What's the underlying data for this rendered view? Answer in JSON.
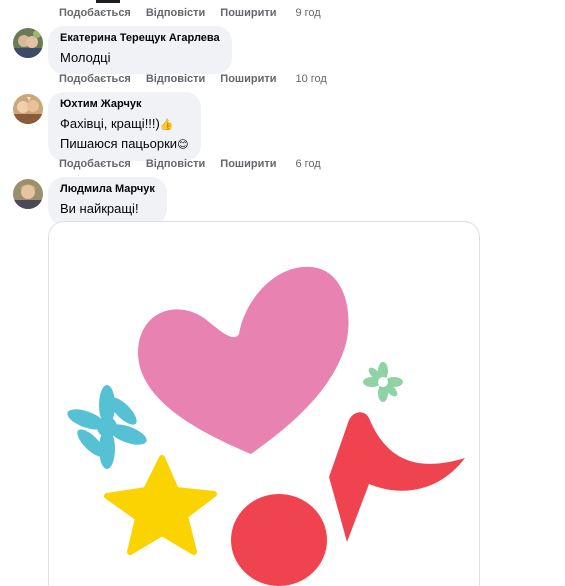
{
  "labels": {
    "like": "Подобається",
    "reply": "Відповісти",
    "share": "Поширити"
  },
  "comments": [
    {
      "time": "9 год"
    },
    {
      "author": "Екатерина Терещук Агарлева",
      "text": "Молодці",
      "time": "10 год"
    },
    {
      "author": "Юхтим Жарчук",
      "line1": "Фахівці, кращі!!!)",
      "emoji1": "👍",
      "line2": "Пишаюся пацьорки",
      "emoji2": "😊",
      "time": "6 год"
    },
    {
      "author": "Людмила Марчук",
      "text": "Ви найкращі!"
    }
  ],
  "sticker": {
    "name": "heart-star-music-sticker",
    "colors": {
      "heart": "#e882b1",
      "note": "#ef4350",
      "star": "#fbd300",
      "flower_blue": "#56c0d4",
      "flower_green": "#8fd3a5"
    }
  }
}
